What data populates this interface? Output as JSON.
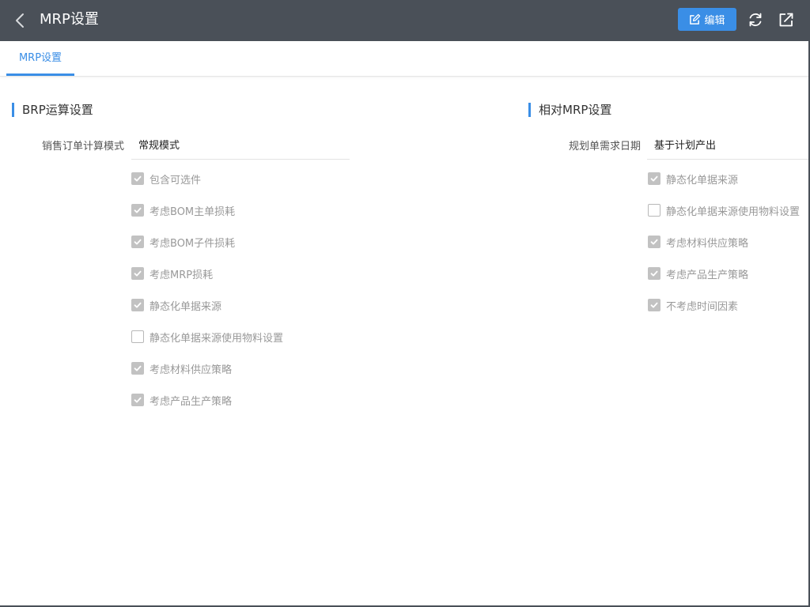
{
  "header": {
    "title": "MRP设置",
    "edit_label": "编辑"
  },
  "tabs": [
    {
      "label": "MRP设置",
      "active": true
    }
  ],
  "left_section": {
    "title": "BRP运算设置",
    "field": {
      "label": "销售订单计算模式",
      "value": "常规模式"
    },
    "checkboxes": [
      {
        "label": "包含可选件",
        "checked": true
      },
      {
        "label": "考虑BOM主单损耗",
        "checked": true
      },
      {
        "label": "考虑BOM子件损耗",
        "checked": true
      },
      {
        "label": "考虑MRP损耗",
        "checked": true
      },
      {
        "label": "静态化单据来源",
        "checked": true
      },
      {
        "label": "静态化单据来源使用物料设置",
        "checked": false
      },
      {
        "label": "考虑材料供应策略",
        "checked": true
      },
      {
        "label": "考虑产品生产策略",
        "checked": true
      }
    ]
  },
  "right_section": {
    "title": "相对MRP设置",
    "field": {
      "label": "规划单需求日期",
      "value": "基于计划产出"
    },
    "checkboxes": [
      {
        "label": "静态化单据来源",
        "checked": true
      },
      {
        "label": "静态化单据来源使用物料设置",
        "checked": false
      },
      {
        "label": "考虑材料供应策略",
        "checked": true
      },
      {
        "label": "考虑产品生产策略",
        "checked": true
      },
      {
        "label": "不考虑时间因素",
        "checked": true
      }
    ]
  },
  "colors": {
    "topbar": "#4a5058",
    "accent": "#3a8ee6",
    "checkbox_checked": "#c2c2c2"
  }
}
